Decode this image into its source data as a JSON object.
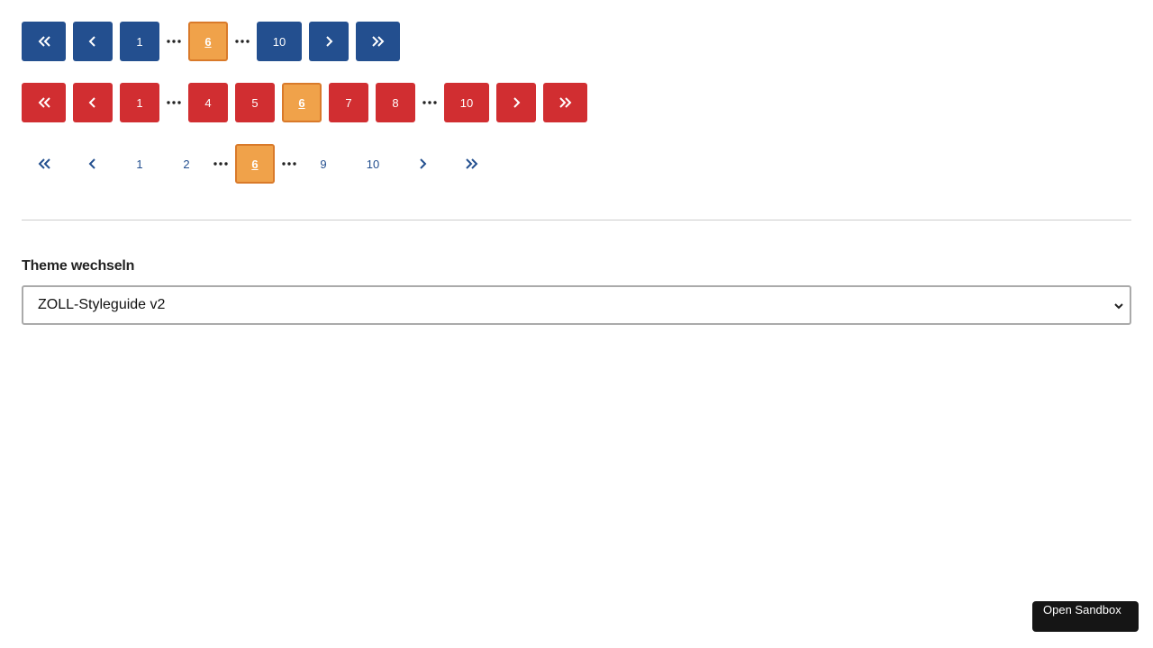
{
  "pagination_blue": {
    "pages": [
      "1",
      "6",
      "10"
    ],
    "current": "6"
  },
  "pagination_red": {
    "pages": [
      "1",
      "4",
      "5",
      "6",
      "7",
      "8",
      "10"
    ],
    "current": "6"
  },
  "pagination_plain": {
    "pages": [
      "1",
      "2",
      "6",
      "9",
      "10"
    ],
    "current": "6"
  },
  "theme": {
    "label": "Theme wechseln",
    "selected": "ZOLL-Styleguide v2"
  },
  "sandbox": {
    "label": "Open Sandbox"
  },
  "colors": {
    "blue": "#234f8f",
    "red": "#d12e31",
    "current": "#f0a24a",
    "current_border": "#d97a2a"
  },
  "icons": {
    "first": "double-chevron-left-icon",
    "prev": "chevron-left-icon",
    "next": "chevron-right-icon",
    "last": "double-chevron-right-icon",
    "gap": "ellipsis-icon"
  }
}
